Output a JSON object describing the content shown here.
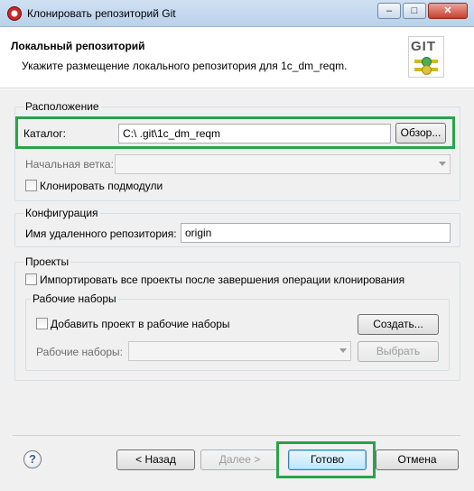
{
  "window": {
    "title": "Клонировать репозиторий Git",
    "controls": {
      "minimize": "–",
      "maximize": "□",
      "close": "✕"
    }
  },
  "header": {
    "title": "Локальный репозиторий",
    "description": "Укажите размещение локального репозитория для 1c_dm_reqm.",
    "logo_text": "GIT"
  },
  "location": {
    "group_label": "Расположение",
    "catalog_label": "Каталог:",
    "catalog_value": "C:\\                        .git\\1c_dm_reqm",
    "browse_button": "Обзор...",
    "branch_label": "Начальная ветка:",
    "clone_submodules_label": "Клонировать подмодули"
  },
  "configuration": {
    "group_label": "Конфигурация",
    "remote_label": "Имя удаленного репозитория:",
    "remote_value": "origin"
  },
  "projects": {
    "group_label": "Проекты",
    "import_label": "Импортировать все проекты после завершения операции клонирования",
    "working_sets": {
      "group_label": "Рабочие наборы",
      "add_label": "Добавить проект в рабочие наборы",
      "create_button": "Создать...",
      "sets_label": "Рабочие наборы:",
      "select_button": "Выбрать"
    }
  },
  "footer": {
    "help_icon": "?",
    "back_button": "< Назад",
    "next_button": "Далее >",
    "finish_button": "Готово",
    "cancel_button": "Отмена"
  },
  "colors": {
    "highlight": "#2aa34a",
    "titlebar": "#b9d1ea",
    "dialog_bg": "#f0f0f0"
  }
}
